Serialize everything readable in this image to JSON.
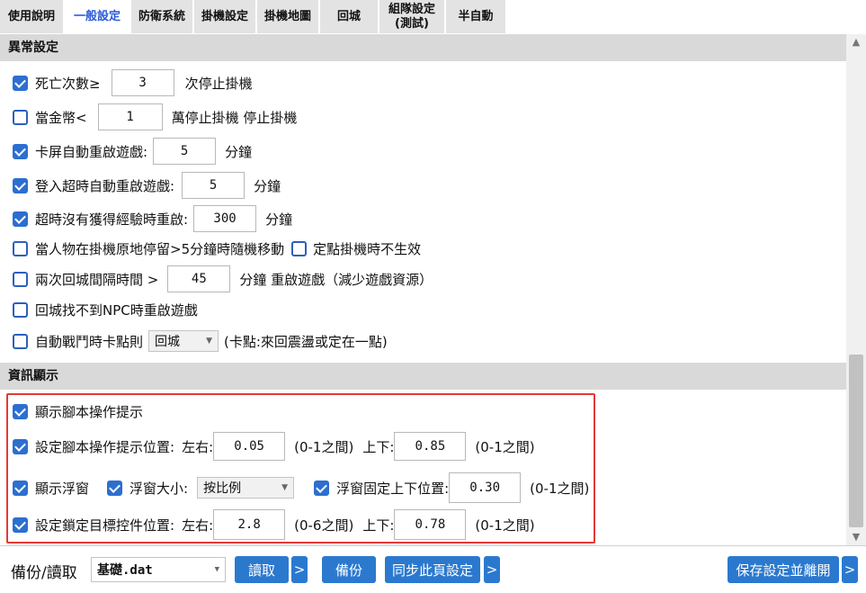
{
  "tabs": [
    {
      "label": "使用說明"
    },
    {
      "label": "一般設定"
    },
    {
      "label": "防衛系統"
    },
    {
      "label": "掛機設定"
    },
    {
      "label": "掛機地圖"
    },
    {
      "label": "回城"
    },
    {
      "label": "組隊設定\n(測試)"
    },
    {
      "label": "半自動"
    }
  ],
  "sections": {
    "abnormal": "異常設定",
    "info": "資訊顯示"
  },
  "abnormal": {
    "death": {
      "label": "死亡次數≥",
      "value": "3",
      "suffix": "次停止掛機",
      "checked": true
    },
    "gold": {
      "label": "當金幣<",
      "value": "1",
      "suffix": "萬停止掛機  停止掛機",
      "checked": false
    },
    "stuck": {
      "label": "卡屏自動重啟遊戲:",
      "value": "5",
      "suffix": "分鐘",
      "checked": true
    },
    "login": {
      "label": "登入超時自動重啟遊戲:",
      "value": "5",
      "suffix": "分鐘",
      "checked": true
    },
    "noexp": {
      "label": "超時沒有獲得經驗時重啟:",
      "value": "300",
      "suffix": "分鐘",
      "checked": true
    },
    "idle": {
      "label": "當人物在掛機原地停留>5分鐘時隨機移動",
      "checked": false
    },
    "fixed": {
      "label": "定點掛機時不生效",
      "checked": false
    },
    "town_interval": {
      "label": "兩次回城間隔時間 >",
      "value": "45",
      "suffix": "分鐘 重啟遊戲（減少遊戲資源）",
      "checked": false
    },
    "npc": {
      "label": "回城找不到NPC時重啟遊戲",
      "checked": false
    },
    "combat_stuck": {
      "label": "自動戰鬥時卡點則",
      "select": "回城",
      "suffix": "(卡點:來回震盪或定在一點)",
      "checked": false
    }
  },
  "info": {
    "show_tips": {
      "label": "顯示腳本操作提示",
      "checked": true
    },
    "tip_pos": {
      "label": "設定腳本操作提示位置:",
      "lr_label": "左右:",
      "lr_value": "0.05",
      "lr_range": "(0-1之間)",
      "ud_label": "上下:",
      "ud_value": "0.85",
      "ud_range": "(0-1之間)",
      "checked": true
    },
    "float": {
      "label": "顯示浮窗",
      "checked": true
    },
    "float_size": {
      "label": "浮窗大小:",
      "select": "按比例",
      "checked": true
    },
    "float_fixed": {
      "label": "浮窗固定上下位置:",
      "value": "0.30",
      "range": "(0-1之間)",
      "checked": true
    },
    "lock_pos": {
      "label": "設定鎖定目標控件位置:",
      "lr_label": "左右:",
      "lr_value": "2.8",
      "lr_range": "(0-6之間)",
      "ud_label": "上下:",
      "ud_value": "0.78",
      "ud_range": "(0-1之間)",
      "checked": true
    }
  },
  "footer": {
    "backup_label": "備份/讀取",
    "file_select": "基礎.dat",
    "read": "讀取",
    "more": ">",
    "backup": "備份",
    "sync": "同步此頁設定",
    "save_exit": "保存設定並離開"
  },
  "icons": {
    "scroll_up": "chevron-up-icon",
    "scroll_down": "chevron-down-icon",
    "select_arrow": "chevron-down-icon"
  },
  "colors": {
    "accent": "#2b79cf",
    "highlight_border": "#e53935",
    "active_tab_text": "#2a5bd7"
  }
}
